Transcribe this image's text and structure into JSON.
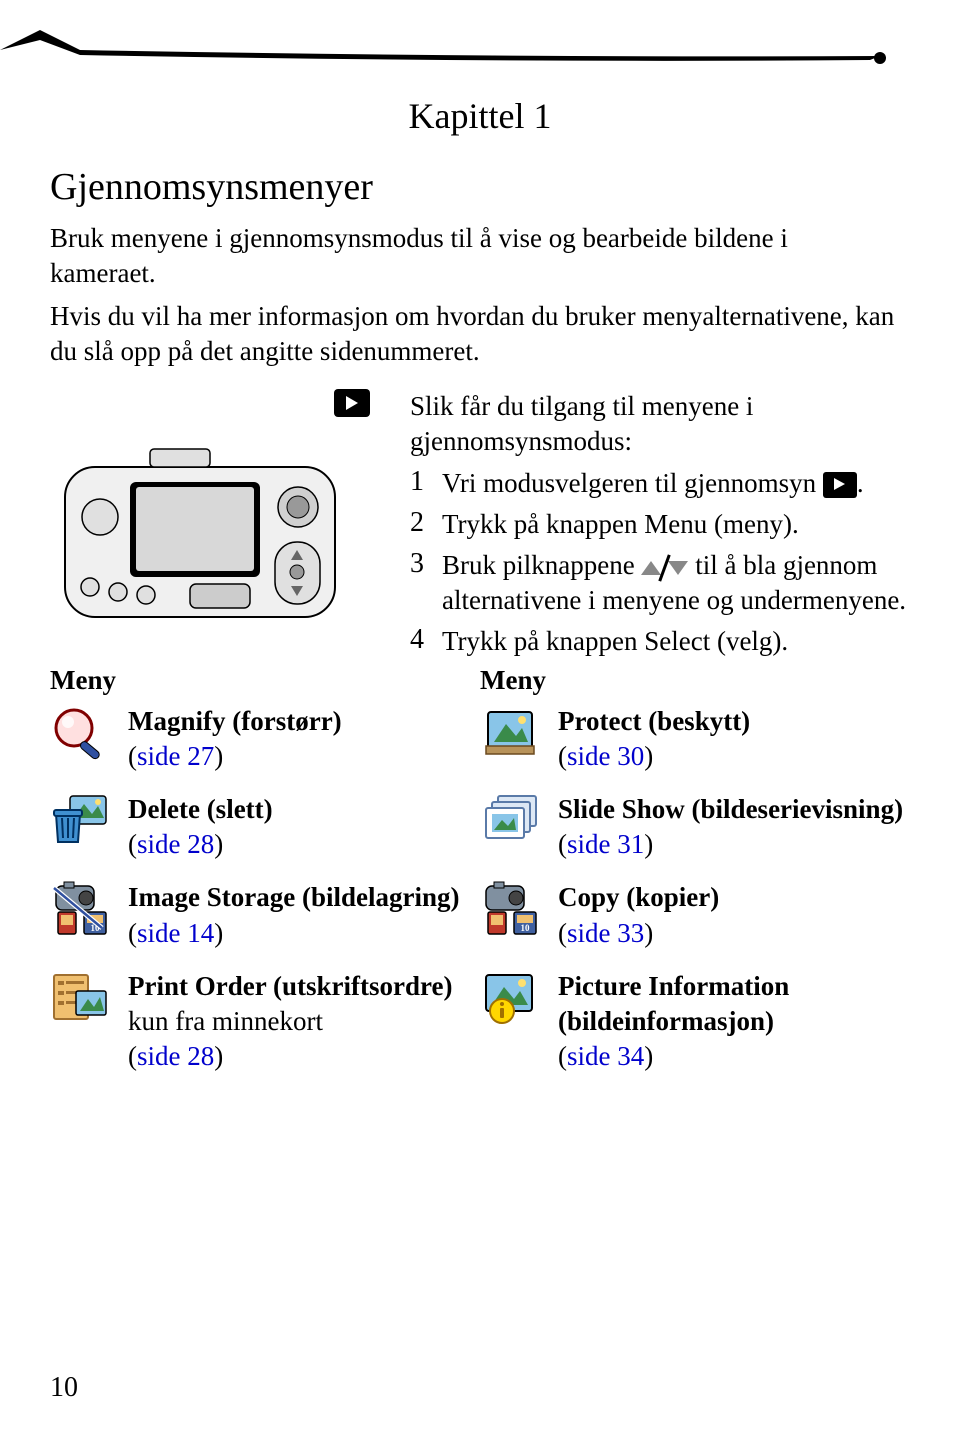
{
  "chapter_title": "Kapittel 1",
  "section_title": "Gjennomsynsmenyer",
  "intro_paragraph_1": "Bruk menyene i gjennomsynsmodus til å vise og bearbeide bildene i kameraet.",
  "intro_paragraph_2": "Hvis du vil ha mer informasjon om hvordan du bruker menyalternativene, kan du slå opp på det angitte sidenummeret.",
  "steps_intro": "Slik får du tilgang til menyene i gjennomsynsmodus:",
  "step1_num": "1",
  "step1_text_a": "Vri modusvelgeren til gjennomsyn ",
  "step1_text_b": ".",
  "step2_num": "2",
  "step2_text": "Trykk på knappen Menu (meny).",
  "step3_num": "3",
  "step3_text_a": "Bruk pilknappene ",
  "step3_text_b": " til å bla gjennom alternativene i menyene og undermenyene.",
  "step4_num": "4",
  "step4_text": "Trykk på knappen Select (velg).",
  "menu_heading_left": "Meny",
  "menu_heading_right": "Meny",
  "menu_left": [
    {
      "title": "Magnify (forstørr)",
      "sub": "",
      "link": "side 27",
      "extra": ""
    },
    {
      "title": "Delete (slett)",
      "sub": "",
      "link": "side 28",
      "extra": ""
    },
    {
      "title": "Image Storage (bildelagring)",
      "sub": "",
      "link": "side 14",
      "extra": ""
    },
    {
      "title": "Print Order (utskriftsordre)",
      "sub": "kun fra minnekort",
      "link": "side 28",
      "extra": ""
    }
  ],
  "menu_right": [
    {
      "title": "Protect (beskytt)",
      "sub": "",
      "link": "side 30",
      "extra": ""
    },
    {
      "title": "Slide Show (bildeserievisning)",
      "sub": "",
      "link": "side 31",
      "extra": ""
    },
    {
      "title": "Copy (kopier)",
      "sub": "",
      "link": "side 33",
      "extra": ""
    },
    {
      "title": "Picture Information (bildeinformasjon)",
      "sub": "",
      "link": "side 34",
      "extra": ""
    }
  ],
  "page_number": "10"
}
